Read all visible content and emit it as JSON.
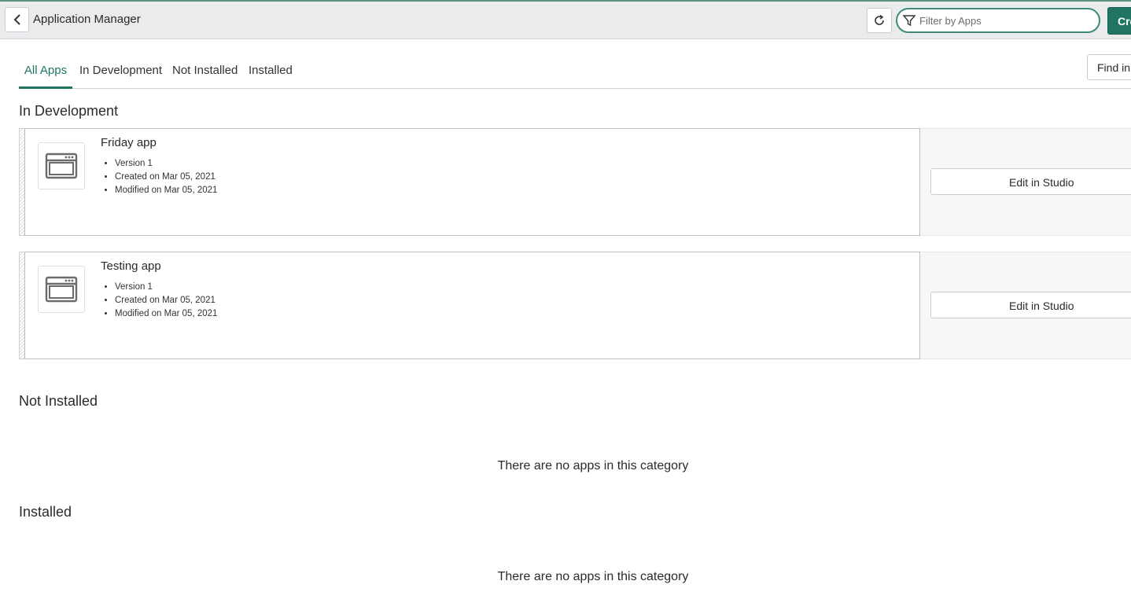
{
  "header": {
    "title": "Application Manager",
    "filter_placeholder": "Filter by Apps",
    "create_label": "Create"
  },
  "tabs": [
    {
      "label": "All Apps",
      "active": true
    },
    {
      "label": "In Development",
      "active": false
    },
    {
      "label": "Not Installed",
      "active": false
    },
    {
      "label": "Installed",
      "active": false
    }
  ],
  "find_button_label": "Find in Store",
  "sections": {
    "in_development": {
      "title": "In Development",
      "apps": [
        {
          "name": "Friday app",
          "version": "Version 1",
          "created": "Created on Mar 05, 2021",
          "modified": "Modified on Mar 05, 2021",
          "action_label": "Edit in Studio"
        },
        {
          "name": "Testing app",
          "version": "Version 1",
          "created": "Created on Mar 05, 2021",
          "modified": "Modified on Mar 05, 2021",
          "action_label": "Edit in Studio"
        }
      ]
    },
    "not_installed": {
      "title": "Not Installed",
      "empty_message": "There are no apps in this category"
    },
    "installed": {
      "title": "Installed",
      "empty_message": "There are no apps in this category"
    }
  },
  "colors": {
    "accent": "#1f7561",
    "filter_border": "#3f8a78",
    "header_bg": "#e9ebec"
  },
  "icons": [
    "chevron-left-icon",
    "refresh-icon",
    "filter-icon",
    "app-window-icon"
  ]
}
